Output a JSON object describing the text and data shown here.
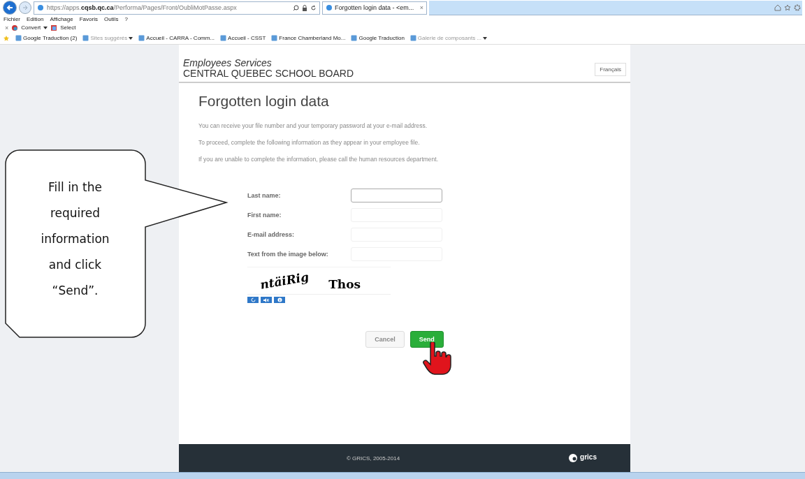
{
  "browser": {
    "url": "https://apps.**cqsb.qc.ca**/Performa/Pages/Front/OubliMotPasse.aspx",
    "tab": {
      "label": "Forgotten login data - <em...",
      "close": "×",
      "selected": true
    },
    "menu": [
      "Fichier",
      "Edition",
      "Affichage",
      "Favoris",
      "Outils",
      "?"
    ],
    "toolbar": {
      "close": "×",
      "convert": "Convert",
      "select": "Select"
    },
    "favorites": [
      {
        "label": "Google Traduction (2)",
        "dropdown": false,
        "muted": false
      },
      {
        "label": "Sites suggérés",
        "dropdown": true,
        "muted": true
      },
      {
        "label": "Accueil - CARRA - Comm...",
        "dropdown": false,
        "muted": false
      },
      {
        "label": "Accueil - CSST",
        "dropdown": false,
        "muted": false
      },
      {
        "label": "France Chamberland Mo...",
        "dropdown": false,
        "muted": false
      },
      {
        "label": "Google Traduction",
        "dropdown": false,
        "muted": false
      },
      {
        "label": "Galerie de composants ...",
        "dropdown": true,
        "muted": true
      }
    ]
  },
  "header": {
    "subtitle": "Employees Services",
    "org": "CENTRAL QUEBEC SCHOOL BOARD",
    "language_button": "Français"
  },
  "title": "Forgotten login data",
  "paragraphs": [
    "You can receive your file number and your temporary password at your e-mail address.",
    "To proceed, complete the following information as they appear in your employee file.",
    "If you are unable to complete the information, please call the human resources department."
  ],
  "fields": [
    {
      "label": "Last name:",
      "focused": true
    },
    {
      "label": "First name:",
      "focused": false
    },
    {
      "label": "E-mail address:",
      "focused": false
    },
    {
      "label": "Text from the image below:",
      "focused": false
    }
  ],
  "captcha": {
    "text_1": "ntäiRig",
    "text_2": "Thos"
  },
  "buttons": [
    {
      "label": "Cancel",
      "kind": "secondary"
    },
    {
      "label": "Send",
      "kind": "primary"
    }
  ],
  "footer": {
    "copyright": "© GRICS, 2005-2014",
    "logo": "grics"
  },
  "callout": "Fill in the required information and click “Send”."
}
